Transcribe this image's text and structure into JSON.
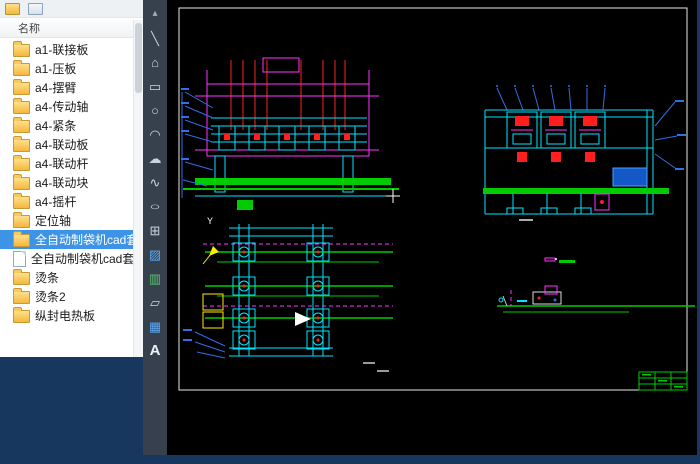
{
  "window": {
    "background": "#17375f",
    "toolbar_background": "#37414e",
    "canvas_background": "#000000"
  },
  "file_panel": {
    "header": "名称",
    "selection_color": "#3d94e6",
    "items": [
      {
        "label": "a1-联接板",
        "icon": "folder",
        "selected": false
      },
      {
        "label": "a1-压板",
        "icon": "folder",
        "selected": false
      },
      {
        "label": "a4-摆臂",
        "icon": "folder",
        "selected": false
      },
      {
        "label": "a4-传动轴",
        "icon": "folder",
        "selected": false
      },
      {
        "label": "a4-紧条",
        "icon": "folder",
        "selected": false
      },
      {
        "label": "a4-联动板",
        "icon": "folder",
        "selected": false
      },
      {
        "label": "a4-联动杆",
        "icon": "folder",
        "selected": false
      },
      {
        "label": "a4-联动块",
        "icon": "folder",
        "selected": false
      },
      {
        "label": "a4-摇杆",
        "icon": "folder",
        "selected": false
      },
      {
        "label": "定位轴",
        "icon": "folder",
        "selected": false
      },
      {
        "label": "全自动制袋机cad套",
        "icon": "folder",
        "selected": true
      },
      {
        "label": "全自动制袋机cad套",
        "icon": "file",
        "selected": false
      },
      {
        "label": "烫条",
        "icon": "folder",
        "selected": false
      },
      {
        "label": "烫条2",
        "icon": "folder",
        "selected": false
      },
      {
        "label": "纵封电热板",
        "icon": "folder",
        "selected": false
      }
    ]
  },
  "toolbar": {
    "tools": [
      {
        "name": "scroll-up",
        "glyph": "▴"
      },
      {
        "name": "line",
        "glyph": "╲"
      },
      {
        "name": "polygon",
        "glyph": "⌂"
      },
      {
        "name": "rectangle",
        "glyph": "▭"
      },
      {
        "name": "circle",
        "glyph": "○"
      },
      {
        "name": "arc",
        "glyph": "◠"
      },
      {
        "name": "revision-cloud",
        "glyph": "☁"
      },
      {
        "name": "spline",
        "glyph": "∿"
      },
      {
        "name": "ellipse",
        "glyph": "○"
      },
      {
        "name": "insert-block",
        "glyph": "⊞"
      },
      {
        "name": "hatch",
        "glyph": "▨"
      },
      {
        "name": "gradient",
        "glyph": "▥"
      },
      {
        "name": "region",
        "glyph": "▱"
      },
      {
        "name": "table",
        "glyph": "▦"
      },
      {
        "name": "text",
        "glyph": "A"
      }
    ]
  },
  "canvas": {
    "y_marker": "Y",
    "colors": {
      "sheet_outline": "#e8e8e8",
      "parts_cyan": "#00e5ff",
      "parts_magenta": "#ff33ff",
      "parts_red": "#ff1f1f",
      "parts_green": "#00cc00",
      "leaders_blue": "#2f6fe8",
      "highlight_yellow": "#ffee00"
    }
  }
}
